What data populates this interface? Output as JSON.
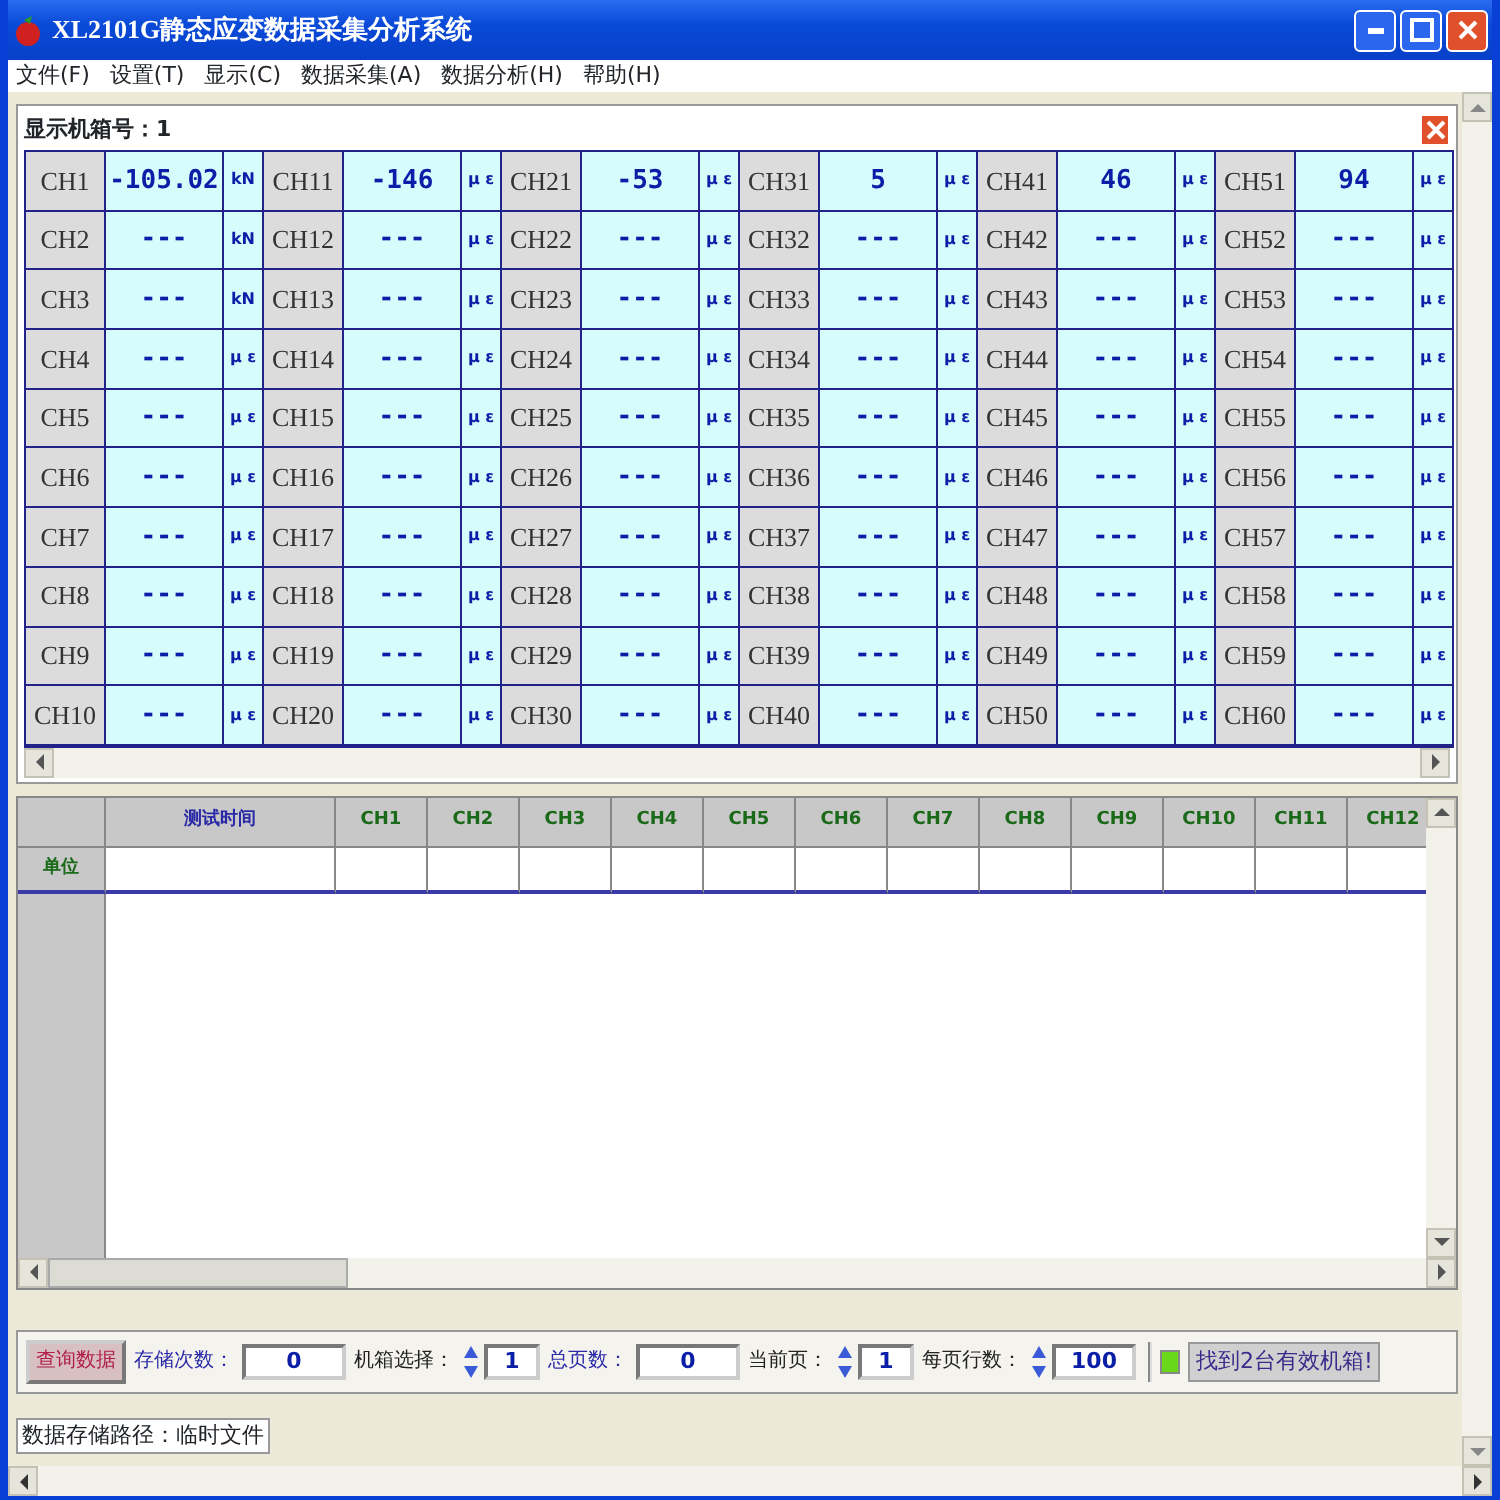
{
  "window": {
    "title": "XL2101G静态应变数据采集分析系统"
  },
  "menu": [
    "文件(F)",
    "设置(T)",
    "显示(C)",
    "数据采集(A)",
    "数据分析(H)",
    "帮助(H)"
  ],
  "panel": {
    "title": "显示机箱号：1"
  },
  "channel_rows": [
    [
      {
        "name": "CH1",
        "value": "-105.02",
        "unit": "kN"
      },
      {
        "name": "CH11",
        "value": "-146",
        "unit": "μ ε"
      },
      {
        "name": "CH21",
        "value": "-53",
        "unit": "μ ε"
      },
      {
        "name": "CH31",
        "value": "5",
        "unit": "μ ε"
      },
      {
        "name": "CH41",
        "value": "46",
        "unit": "μ ε"
      },
      {
        "name": "CH51",
        "value": "94",
        "unit": "μ ε"
      }
    ],
    [
      {
        "name": "CH2",
        "value": "---",
        "unit": "kN"
      },
      {
        "name": "CH12",
        "value": "---",
        "unit": "μ ε"
      },
      {
        "name": "CH22",
        "value": "---",
        "unit": "μ ε"
      },
      {
        "name": "CH32",
        "value": "---",
        "unit": "μ ε"
      },
      {
        "name": "CH42",
        "value": "---",
        "unit": "μ ε"
      },
      {
        "name": "CH52",
        "value": "---",
        "unit": "μ ε"
      }
    ],
    [
      {
        "name": "CH3",
        "value": "---",
        "unit": "kN"
      },
      {
        "name": "CH13",
        "value": "---",
        "unit": "μ ε"
      },
      {
        "name": "CH23",
        "value": "---",
        "unit": "μ ε"
      },
      {
        "name": "CH33",
        "value": "---",
        "unit": "μ ε"
      },
      {
        "name": "CH43",
        "value": "---",
        "unit": "μ ε"
      },
      {
        "name": "CH53",
        "value": "---",
        "unit": "μ ε"
      }
    ],
    [
      {
        "name": "CH4",
        "value": "---",
        "unit": "μ ε"
      },
      {
        "name": "CH14",
        "value": "---",
        "unit": "μ ε"
      },
      {
        "name": "CH24",
        "value": "---",
        "unit": "μ ε"
      },
      {
        "name": "CH34",
        "value": "---",
        "unit": "μ ε"
      },
      {
        "name": "CH44",
        "value": "---",
        "unit": "μ ε"
      },
      {
        "name": "CH54",
        "value": "---",
        "unit": "μ ε"
      }
    ],
    [
      {
        "name": "CH5",
        "value": "---",
        "unit": "μ ε"
      },
      {
        "name": "CH15",
        "value": "---",
        "unit": "μ ε"
      },
      {
        "name": "CH25",
        "value": "---",
        "unit": "μ ε"
      },
      {
        "name": "CH35",
        "value": "---",
        "unit": "μ ε"
      },
      {
        "name": "CH45",
        "value": "---",
        "unit": "μ ε"
      },
      {
        "name": "CH55",
        "value": "---",
        "unit": "μ ε"
      }
    ],
    [
      {
        "name": "CH6",
        "value": "---",
        "unit": "μ ε"
      },
      {
        "name": "CH16",
        "value": "---",
        "unit": "μ ε"
      },
      {
        "name": "CH26",
        "value": "---",
        "unit": "μ ε"
      },
      {
        "name": "CH36",
        "value": "---",
        "unit": "μ ε"
      },
      {
        "name": "CH46",
        "value": "---",
        "unit": "μ ε"
      },
      {
        "name": "CH56",
        "value": "---",
        "unit": "μ ε"
      }
    ],
    [
      {
        "name": "CH7",
        "value": "---",
        "unit": "μ ε"
      },
      {
        "name": "CH17",
        "value": "---",
        "unit": "μ ε"
      },
      {
        "name": "CH27",
        "value": "---",
        "unit": "μ ε"
      },
      {
        "name": "CH37",
        "value": "---",
        "unit": "μ ε"
      },
      {
        "name": "CH47",
        "value": "---",
        "unit": "μ ε"
      },
      {
        "name": "CH57",
        "value": "---",
        "unit": "μ ε"
      }
    ],
    [
      {
        "name": "CH8",
        "value": "---",
        "unit": "μ ε"
      },
      {
        "name": "CH18",
        "value": "---",
        "unit": "μ ε"
      },
      {
        "name": "CH28",
        "value": "---",
        "unit": "μ ε"
      },
      {
        "name": "CH38",
        "value": "---",
        "unit": "μ ε"
      },
      {
        "name": "CH48",
        "value": "---",
        "unit": "μ ε"
      },
      {
        "name": "CH58",
        "value": "---",
        "unit": "μ ε"
      }
    ],
    [
      {
        "name": "CH9",
        "value": "---",
        "unit": "μ ε"
      },
      {
        "name": "CH19",
        "value": "---",
        "unit": "μ ε"
      },
      {
        "name": "CH29",
        "value": "---",
        "unit": "μ ε"
      },
      {
        "name": "CH39",
        "value": "---",
        "unit": "μ ε"
      },
      {
        "name": "CH49",
        "value": "---",
        "unit": "μ ε"
      },
      {
        "name": "CH59",
        "value": "---",
        "unit": "μ ε"
      }
    ],
    [
      {
        "name": "CH10",
        "value": "---",
        "unit": "μ ε"
      },
      {
        "name": "CH20",
        "value": "---",
        "unit": "μ ε"
      },
      {
        "name": "CH30",
        "value": "---",
        "unit": "μ ε"
      },
      {
        "name": "CH40",
        "value": "---",
        "unit": "μ ε"
      },
      {
        "name": "CH50",
        "value": "---",
        "unit": "μ ε"
      },
      {
        "name": "CH60",
        "value": "---",
        "unit": "μ ε"
      }
    ]
  ],
  "log_table": {
    "columns": [
      "测试时间",
      "CH1",
      "CH2",
      "CH3",
      "CH4",
      "CH5",
      "CH6",
      "CH7",
      "CH8",
      "CH9",
      "CH10",
      "CH11",
      "CH12"
    ],
    "rows": [
      {
        "label": "单位"
      }
    ]
  },
  "controls": [
    {
      "kind": "button",
      "label": "查询数据"
    },
    {
      "kind": "field",
      "label": "存储次数：",
      "value": "0"
    },
    {
      "kind": "spin",
      "label": "机箱选择：",
      "value": "1"
    },
    {
      "kind": "field",
      "label": "总页数：",
      "value": "0"
    },
    {
      "kind": "spin",
      "label": "当前页：",
      "value": "1"
    },
    {
      "kind": "spin",
      "label": "每页行数：",
      "value": "100"
    }
  ],
  "status": {
    "text": "找到2台有效机箱!",
    "on": true
  },
  "path_label": "数据存储路径：临时文件"
}
